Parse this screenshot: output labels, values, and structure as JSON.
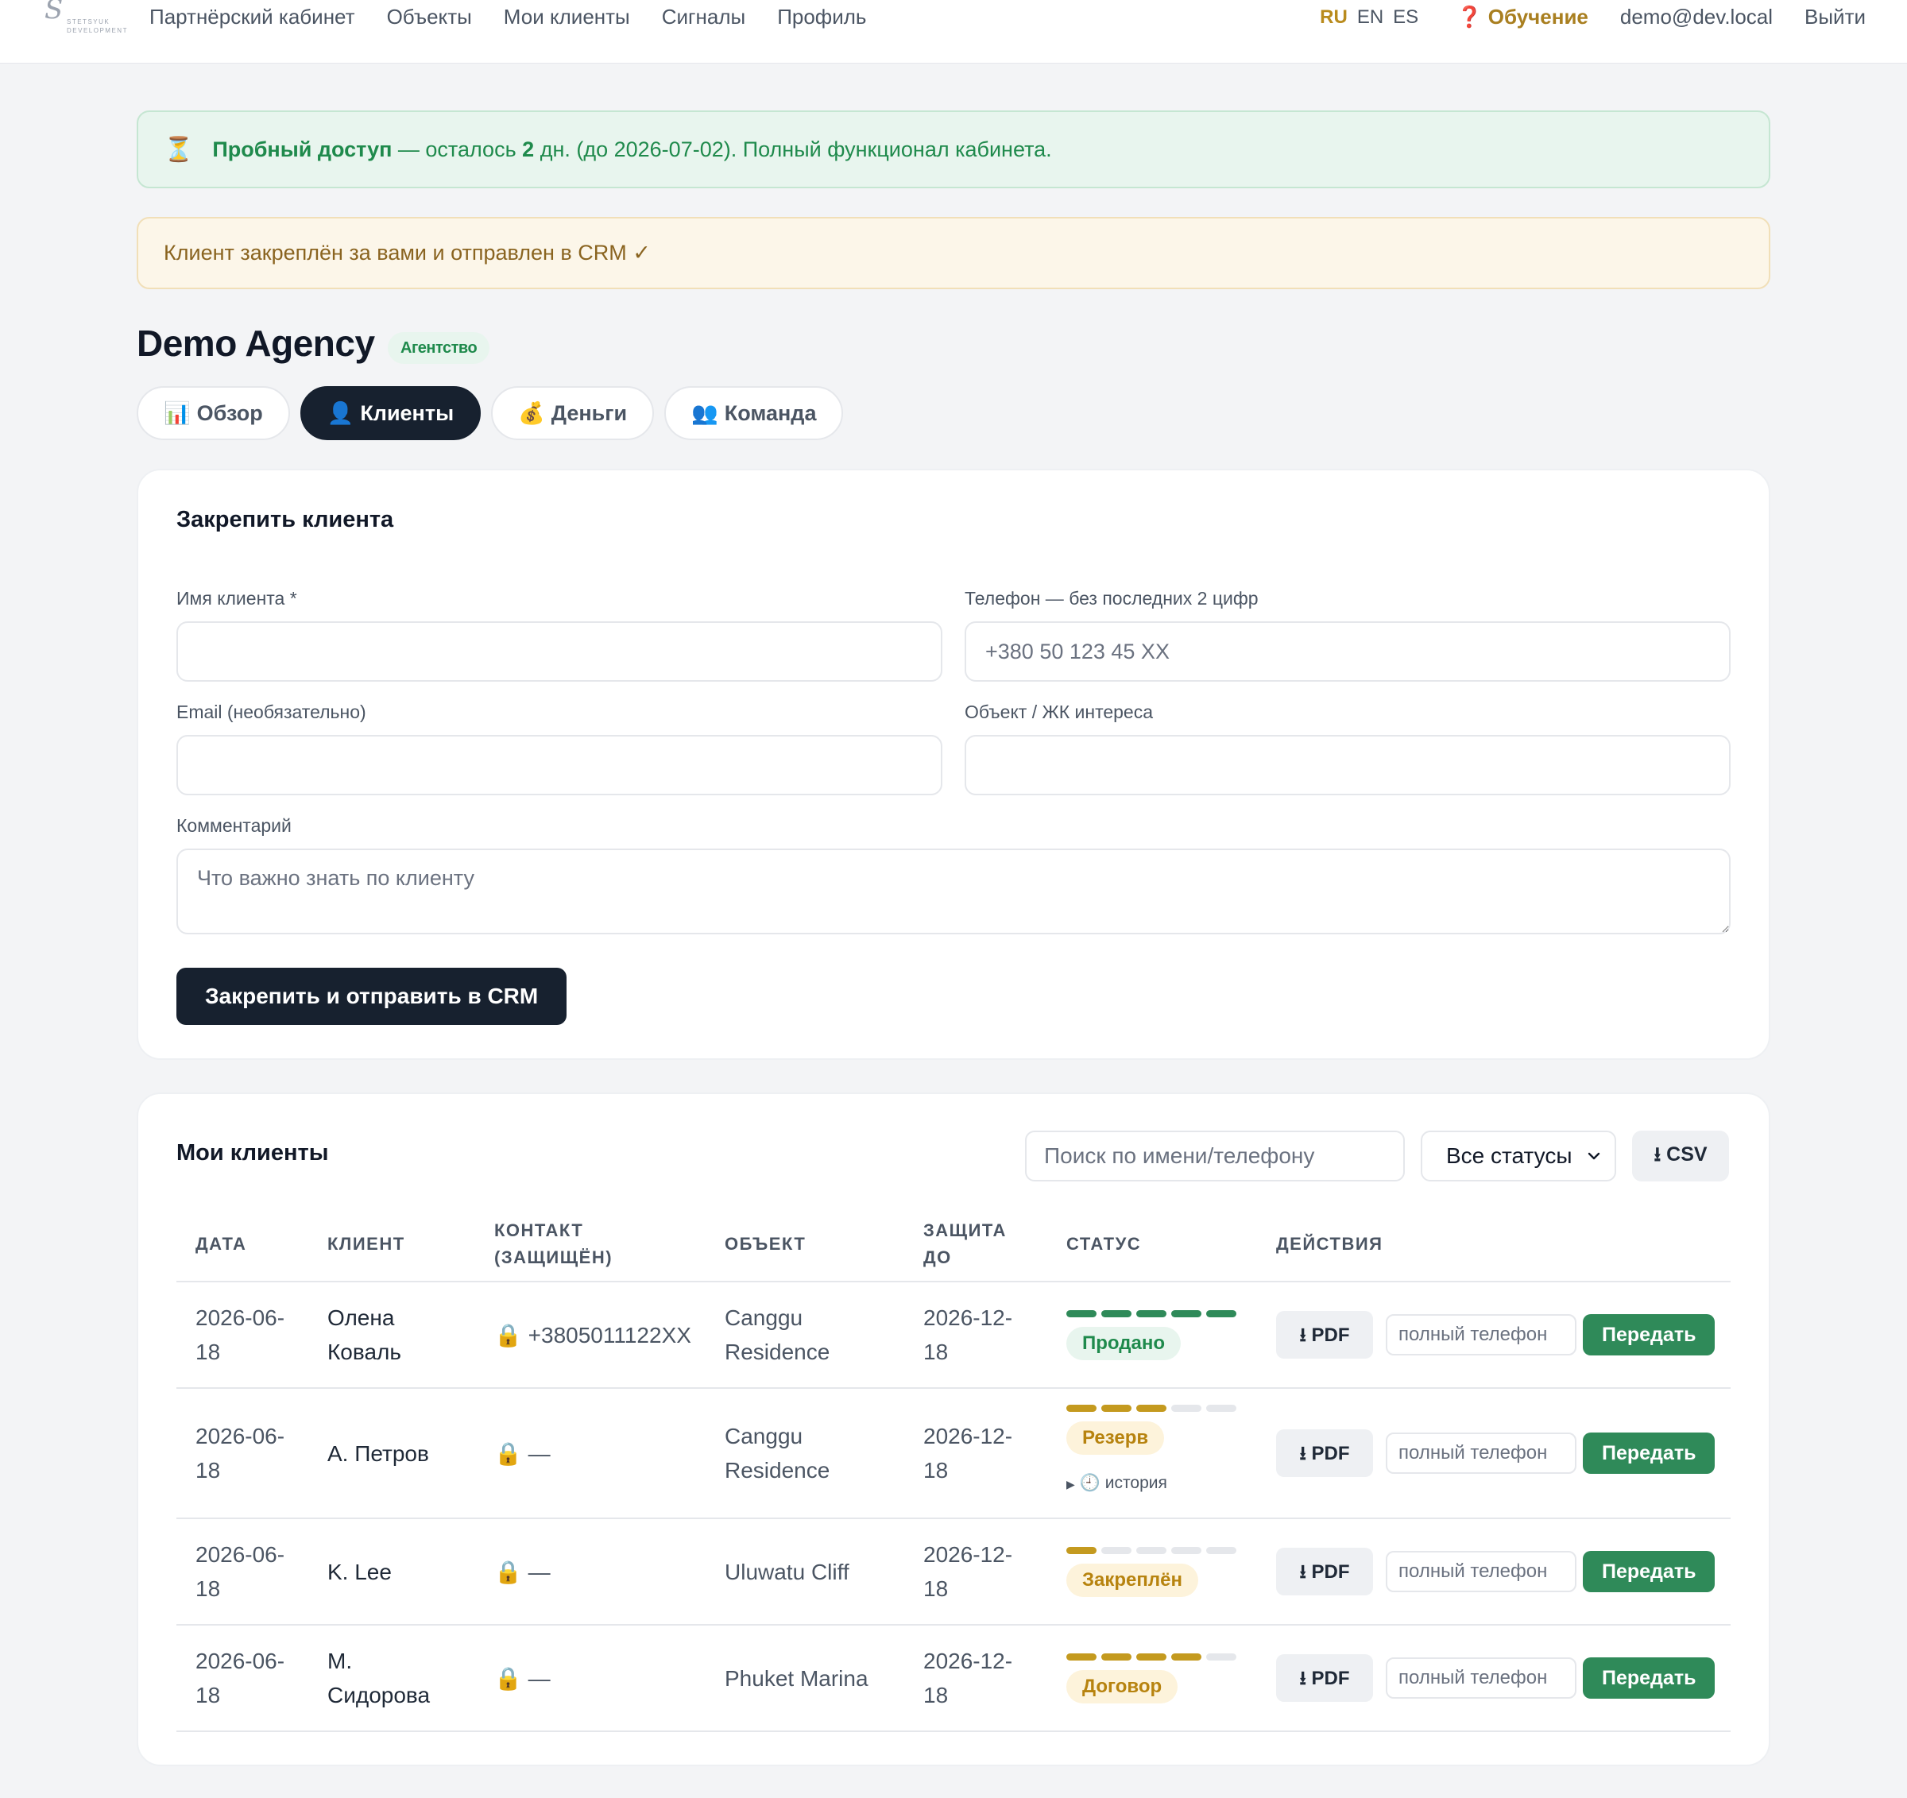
{
  "nav": {
    "logo_text_line1": "STETSYUK",
    "logo_text_line2": "DEVELOPMENT",
    "links": [
      "Партнёрский кабинет",
      "Объекты",
      "Мои клиенты",
      "Сигналы",
      "Профиль"
    ],
    "languages": [
      "RU",
      "EN",
      "ES"
    ],
    "active_language": "RU",
    "learning": "Обучение",
    "user_email": "demo@dev.local",
    "logout": "Выйти"
  },
  "trial_banner": {
    "icon": "hourglass-icon",
    "title": "Пробный доступ",
    "text_before": " — осталось ",
    "days": "2",
    "text_after": " дн. (до 2026-07-02). Полный функционал кабинета."
  },
  "success_banner": {
    "text": "Клиент закреплён за вами и отправлен в CRM ✓"
  },
  "agency": {
    "name": "Demo Agency",
    "badge": "Агентство"
  },
  "tabs": [
    {
      "icon": "📊",
      "label": "Обзор",
      "active": false
    },
    {
      "icon": "👤",
      "label": "Клиенты",
      "active": true
    },
    {
      "icon": "💰",
      "label": "Деньги",
      "active": false
    },
    {
      "icon": "👥",
      "label": "Команда",
      "active": false
    }
  ],
  "form": {
    "title": "Закрепить клиента",
    "name_label": "Имя клиента *",
    "name_value": "",
    "phone_label": "Телефон — без последних 2 цифр",
    "phone_placeholder": "+380 50 123 45 XX",
    "email_label": "Email (необязательно)",
    "email_value": "",
    "object_label": "Объект / ЖК интереса",
    "object_value": "",
    "comment_label": "Комментарий",
    "comment_placeholder": "Что важно знать по клиенту",
    "submit": "Закрепить и отправить в CRM"
  },
  "clients": {
    "title": "Мои клиенты",
    "search_placeholder": "Поиск по имени/телефону",
    "status_filter": "Все статусы",
    "csv": "⭳ CSV",
    "columns": [
      "Дата",
      "Клиент",
      "Контакт (защищён)",
      "Объект",
      "Защита до",
      "Статус",
      "Действия"
    ],
    "pdf_label": "⭳ PDF",
    "phone_input_placeholder": "полный телефон",
    "transfer_label": "Передать",
    "history_label": "история",
    "rows": [
      {
        "date": "2026-06-18",
        "client": "Олена Коваль",
        "contact": "+3805011122XX",
        "object": "Canggu Residence",
        "protected_until": "2026-12-18",
        "status": "Продано",
        "progress_steps": 5,
        "progress_total": 5,
        "status_color": "#2f8a59",
        "pill_bg": "#e8f5ee",
        "pill_fg": "#1f8a4c",
        "has_history": false
      },
      {
        "date": "2026-06-18",
        "client": "А. Петров",
        "contact": "—",
        "object": "Canggu Residence",
        "protected_until": "2026-12-18",
        "status": "Резерв",
        "progress_steps": 3,
        "progress_total": 5,
        "status_color": "#c49a1f",
        "pill_bg": "#fdf3db",
        "pill_fg": "#b7830f",
        "has_history": true
      },
      {
        "date": "2026-06-18",
        "client": "K. Lee",
        "contact": "—",
        "object": "Uluwatu Cliff",
        "protected_until": "2026-12-18",
        "status": "Закреплён",
        "progress_steps": 1,
        "progress_total": 5,
        "status_color": "#c49a1f",
        "pill_bg": "#fdf3db",
        "pill_fg": "#b7830f",
        "has_history": false
      },
      {
        "date": "2026-06-18",
        "client": "М. Сидорова",
        "contact": "—",
        "object": "Phuket Marina",
        "protected_until": "2026-12-18",
        "status": "Договор",
        "progress_steps": 4,
        "progress_total": 5,
        "status_color": "#c49a1f",
        "pill_bg": "#fdf3db",
        "pill_fg": "#b7830f",
        "has_history": false
      }
    ]
  }
}
